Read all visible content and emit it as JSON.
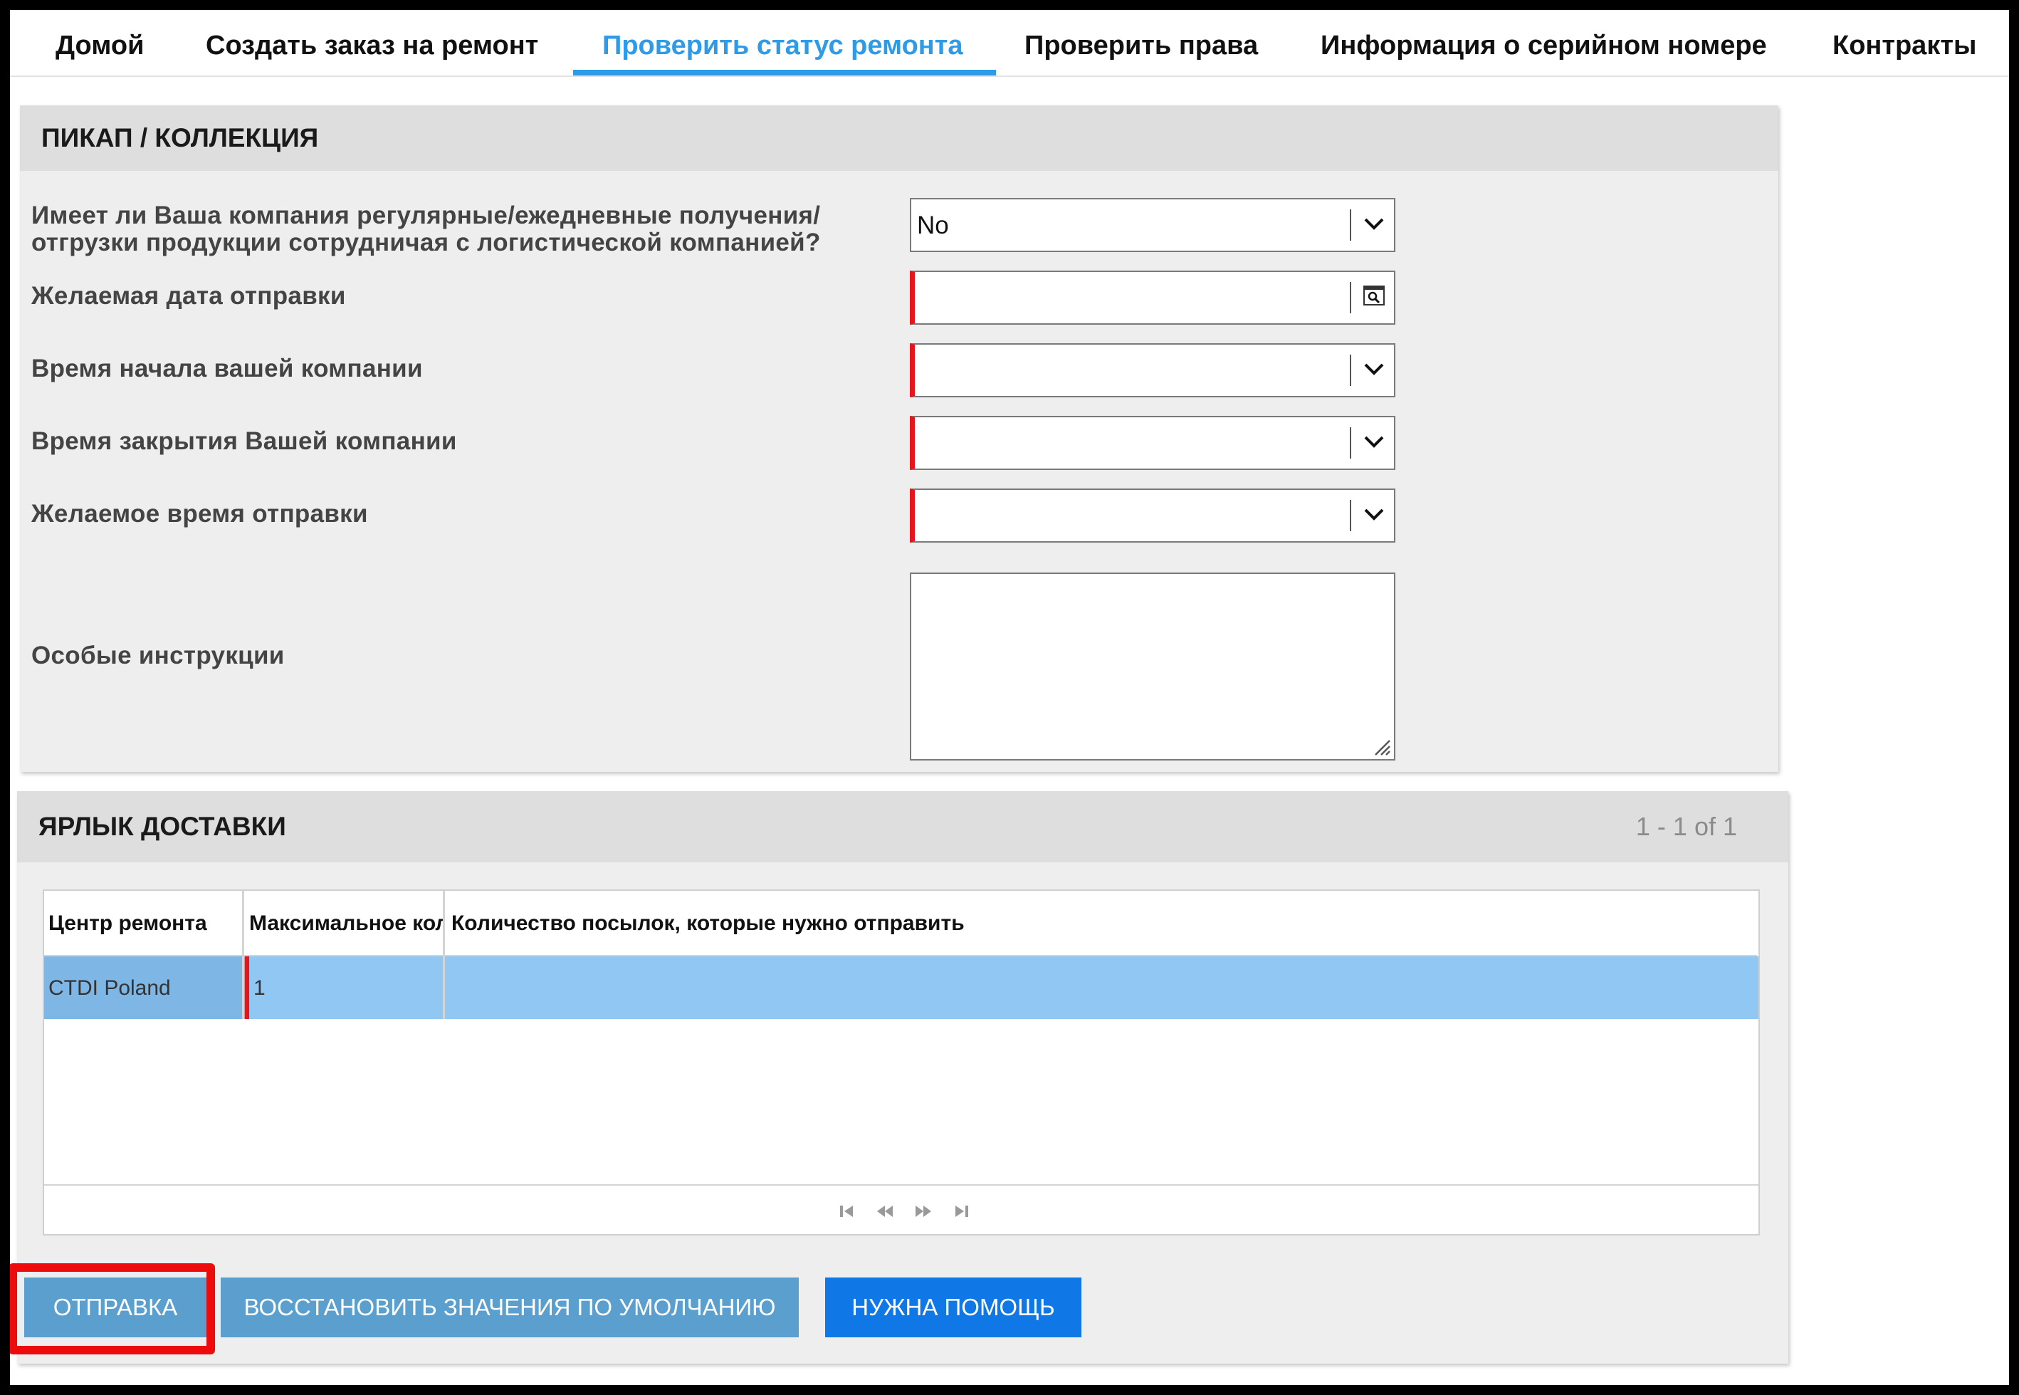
{
  "nav": {
    "tabs": [
      {
        "label": "Домой"
      },
      {
        "label": "Создать заказ на ремонт"
      },
      {
        "label": "Проверить статус ремонта",
        "active": true
      },
      {
        "label": "Проверить права"
      },
      {
        "label": "Информация о серийном номере"
      },
      {
        "label": "Контракты"
      }
    ]
  },
  "pickup": {
    "title": "ПИКАП / КОЛЛЕКЦИЯ",
    "fields": [
      {
        "label_line1": "Имеет ли Ваша компания регулярные/ежедневные получения/",
        "label_line2": "отгрузки продукции сотрудничая с логистической компанией?",
        "value": "No",
        "type": "dropdown",
        "icon": "chevron-down-icon"
      },
      {
        "label": "Желаемая дата отправки",
        "value": "",
        "type": "date",
        "required": true,
        "icon": "calendar-search-icon"
      },
      {
        "label": "Время начала вашей компании",
        "value": "",
        "type": "dropdown",
        "required": true,
        "icon": "chevron-down-icon"
      },
      {
        "label": "Время закрытия Вашей компании",
        "value": "",
        "type": "dropdown",
        "required": true,
        "icon": "chevron-down-icon"
      },
      {
        "label": "Желаемое время отправки",
        "value": "",
        "type": "dropdown",
        "required": true,
        "icon": "chevron-down-icon"
      },
      {
        "label": "Особые инструкции",
        "value": "",
        "type": "textarea"
      }
    ]
  },
  "shipping": {
    "title": "ЯРЛЫК ДОСТАВКИ",
    "pager_text": "1 - 1 of 1",
    "columns": [
      "Центр ремонта",
      "Максимальное кол",
      "Количество посылок, которые нужно отправить"
    ],
    "rows": [
      {
        "repair_center": "CTDI Poland",
        "max_qty": "1",
        "packages": ""
      }
    ],
    "pager_icons": [
      "first-page-icon",
      "prev-page-icon",
      "next-page-icon",
      "last-page-icon"
    ]
  },
  "buttons": {
    "submit": "ОТПРАВКА",
    "reset": "ВОССТАНОВИТЬ ЗНАЧЕНИЯ ПО УМОЛЧАНИЮ",
    "help": "НУЖНА ПОМОЩЬ"
  },
  "colors": {
    "accent": "#2d9be8",
    "required": "#e3151d",
    "highlight": "#ee0b0b",
    "selected_row": "#91c7f3",
    "button": "#5b9fcf",
    "help_button": "#0f78e6"
  }
}
